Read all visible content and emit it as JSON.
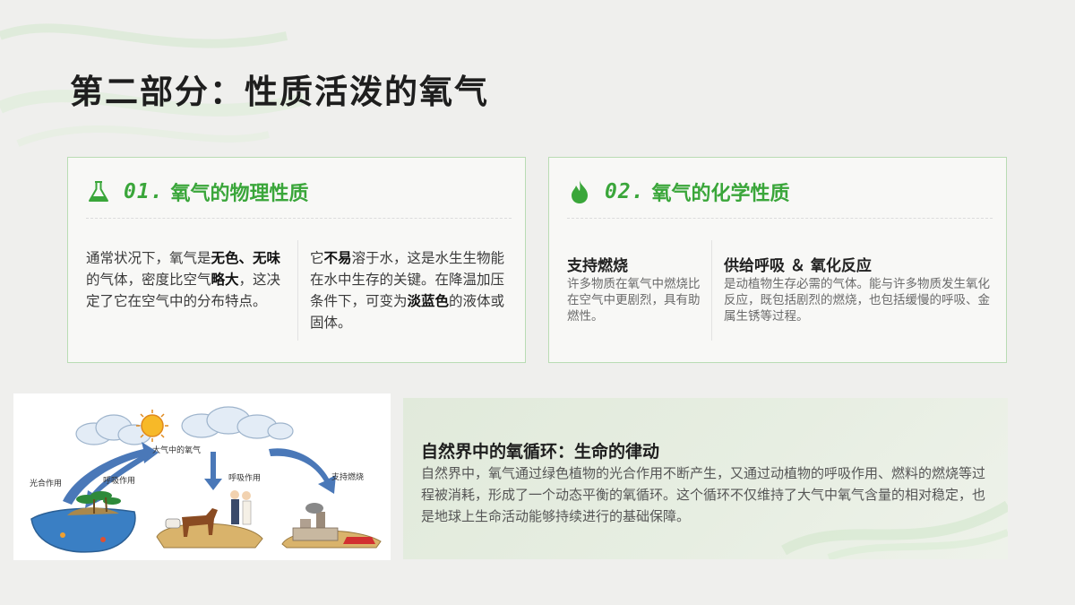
{
  "title": "第二部分：性质活泼的氧气",
  "cards": {
    "physical": {
      "number": "01.",
      "heading": "氧气的物理性质",
      "col1": {
        "p1": "通常状况下，氧气是",
        "b1": "无色、无味",
        "p2": "的气体，密度比空气",
        "b2": "略大",
        "p3": "，这决定了它在空气中的分布特点。"
      },
      "col2": {
        "p1": "它",
        "b1": "不易",
        "p2": "溶于水，这是水生生物能在水中生存的关键。在降温加压条件下，可变为",
        "b2": "淡蓝色",
        "p3": "的液体或固体。"
      }
    },
    "chemical": {
      "number": "02.",
      "heading": "氧气的化学性质",
      "left_title": "支持燃烧",
      "left_desc": "许多物质在氧气中燃烧比在空气中更剧烈，具有助燃性。",
      "right_title": "供给呼吸 ＆ 氧化反应",
      "right_desc": "是动植物生存必需的气体。能与许多物质发生氧化反应，既包括剧烈的燃烧，也包括缓慢的呼吸、金属生锈等过程。"
    }
  },
  "cycle_image": {
    "label_air": "大气中的氧气",
    "label_photo": "光合作用",
    "label_resp1": "呼吸作用",
    "label_resp2": "呼吸作用",
    "label_burn": "支持燃烧"
  },
  "info": {
    "title": "自然界中的氧循环：生命的律动",
    "text": "自然界中，氧气通过绿色植物的光合作用不断产生，又通过动植物的呼吸作用、燃料的燃烧等过程被消耗，形成了一个动态平衡的氧循环。这个循环不仅维持了大气中氧气含量的相对稳定，也是地球上生命活动能够持续进行的基础保障。"
  },
  "colors": {
    "accent_green": "#3aa63a",
    "card_border": "#b9dcb4",
    "background": "#efefed"
  },
  "icons": {
    "physical": "flask-icon",
    "chemical": "flame-icon"
  }
}
